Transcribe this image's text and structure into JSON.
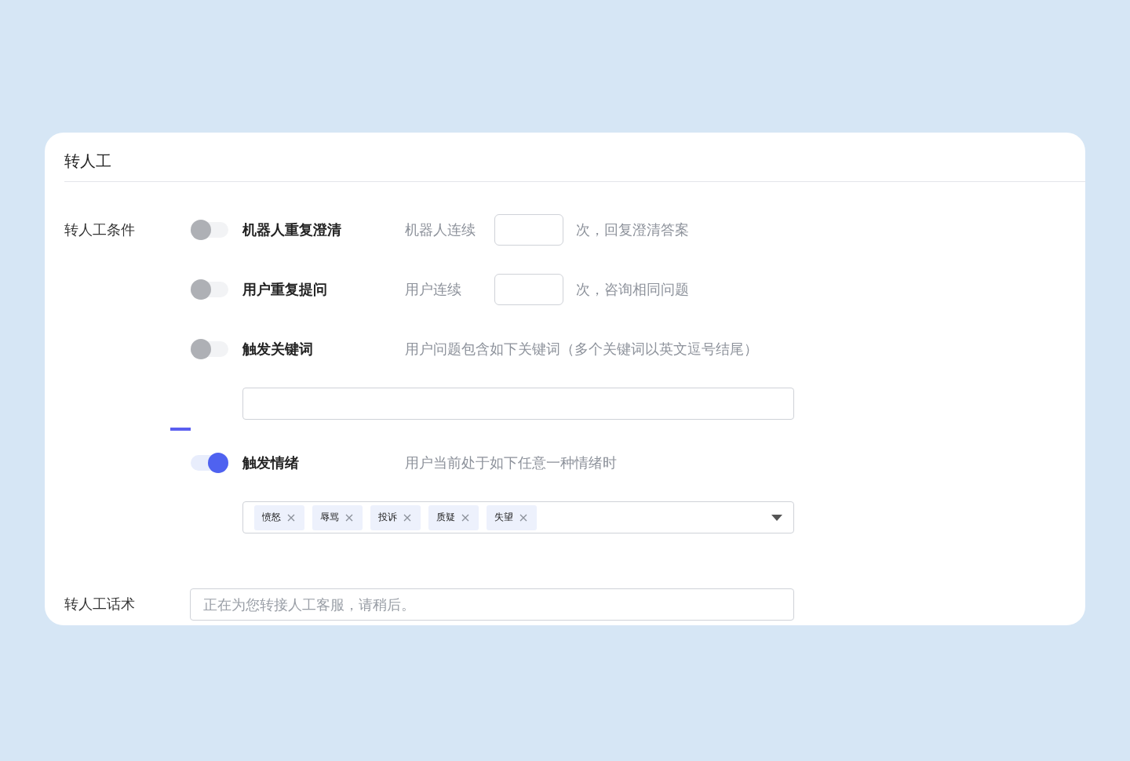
{
  "card": {
    "title": "转人工"
  },
  "conditions": {
    "label": "转人工条件",
    "items": [
      {
        "kind": "count",
        "name": "机器人重复澄清",
        "on": false,
        "prefix": "机器人连续",
        "suffix": "次，回复澄清答案"
      },
      {
        "kind": "count",
        "name": "用户重复提问",
        "on": false,
        "prefix": "用户连续",
        "suffix": "次，咨询相同问题"
      },
      {
        "kind": "keywords",
        "name": "触发关键词",
        "on": false,
        "hint": "用户问题包含如下关键词（多个关键词以英文逗号结尾）"
      },
      {
        "kind": "emotions",
        "name": "触发情绪",
        "on": true,
        "hint": "用户当前处于如下任意一种情绪时",
        "tags": [
          "愤怒",
          "辱骂",
          "投诉",
          "质疑",
          "失望"
        ]
      }
    ]
  },
  "script": {
    "label": "转人工话术",
    "placeholder": "正在为您转接人工客服，请稍后。"
  }
}
